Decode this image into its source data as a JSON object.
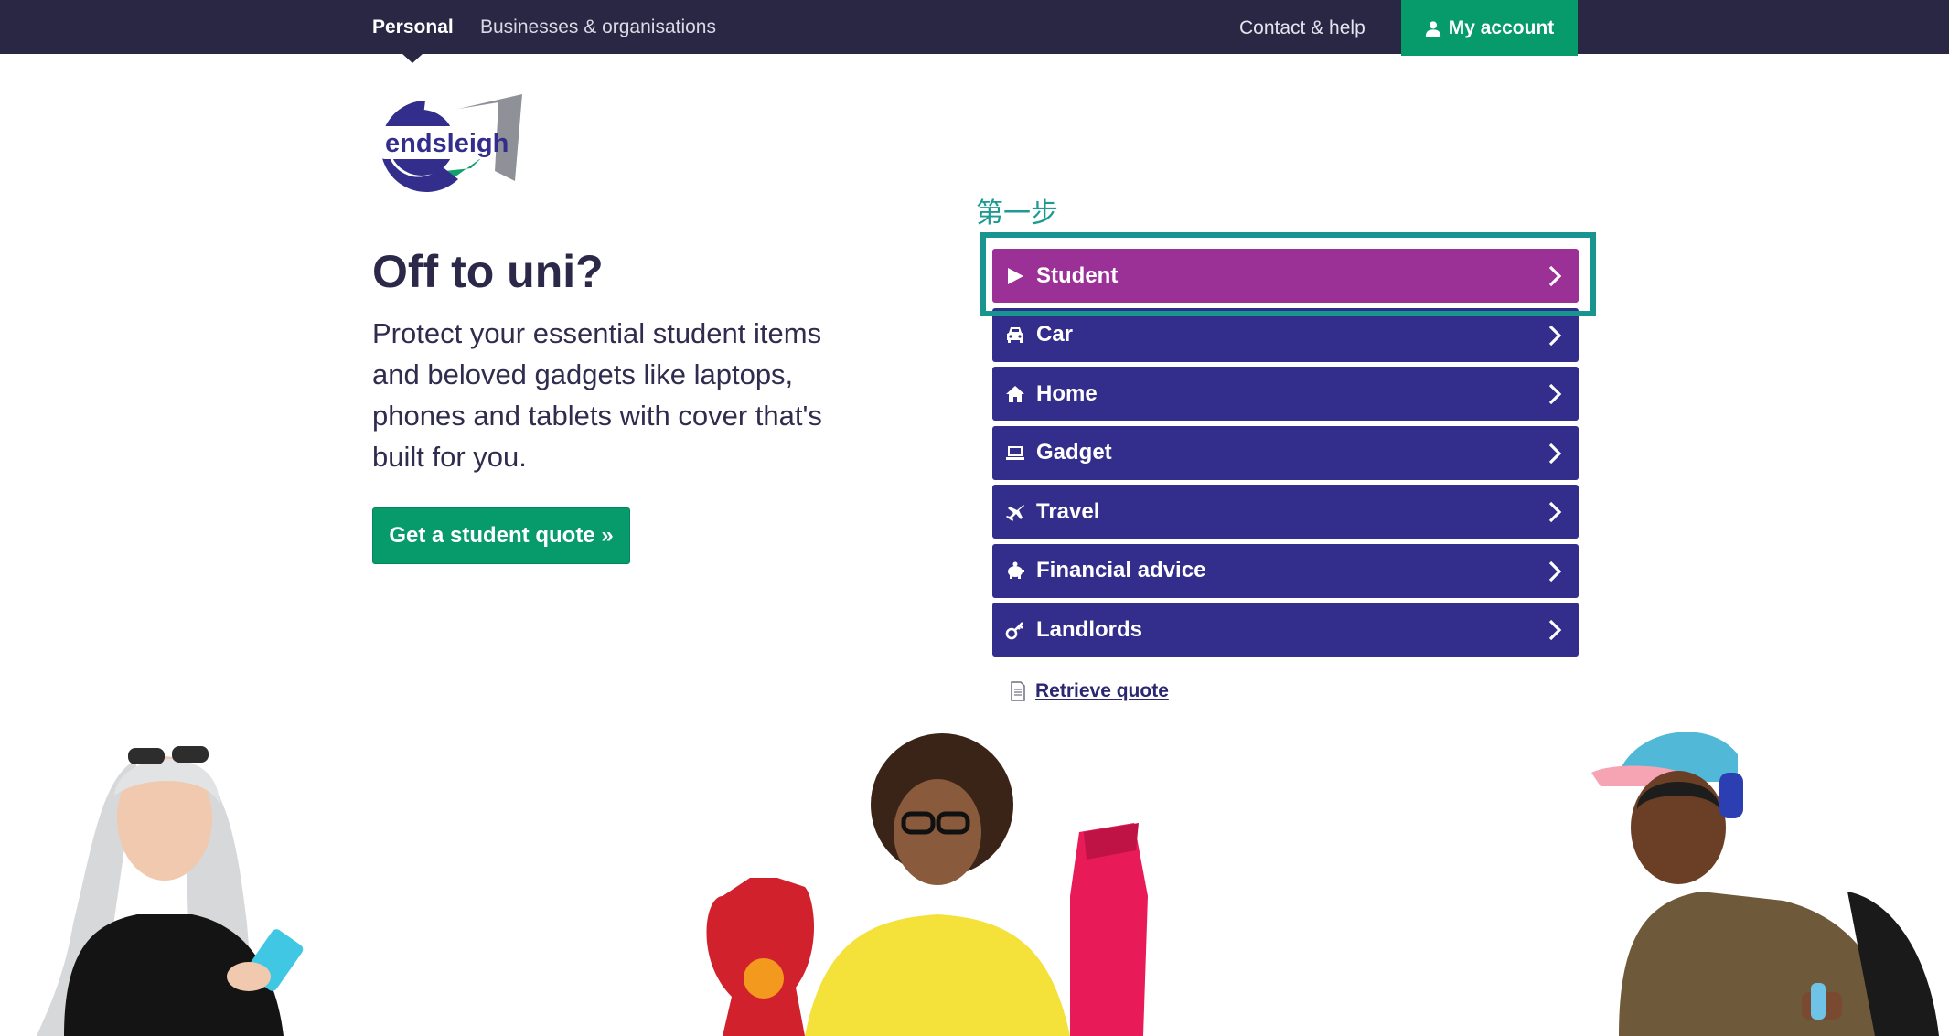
{
  "topbar": {
    "personal": "Personal",
    "business": "Businesses & organisations",
    "contact": "Contact & help",
    "account": "My account"
  },
  "logo": {
    "text": "endsleigh"
  },
  "hero": {
    "title": "Off to uni?",
    "text": "Protect your essential student items and beloved gadgets like laptops, phones and tablets with cover that's built for you.",
    "cta": "Get a student quote »"
  },
  "annotation": {
    "label": "第一步"
  },
  "menu": {
    "items": [
      {
        "label": "Student",
        "icon": "play-icon"
      },
      {
        "label": "Car",
        "icon": "car-icon"
      },
      {
        "label": "Home",
        "icon": "home-icon"
      },
      {
        "label": "Gadget",
        "icon": "laptop-icon"
      },
      {
        "label": "Travel",
        "icon": "plane-icon"
      },
      {
        "label": "Financial advice",
        "icon": "piggy-bank-icon"
      },
      {
        "label": "Landlords",
        "icon": "key-icon"
      }
    ],
    "retrieve": "Retrieve quote"
  },
  "colors": {
    "nav_bg": "#2a2745",
    "brand_green": "#079b6c",
    "menu_purple": "#332d8c",
    "menu_active": "#9b3096",
    "annotation_teal": "#17958e"
  }
}
